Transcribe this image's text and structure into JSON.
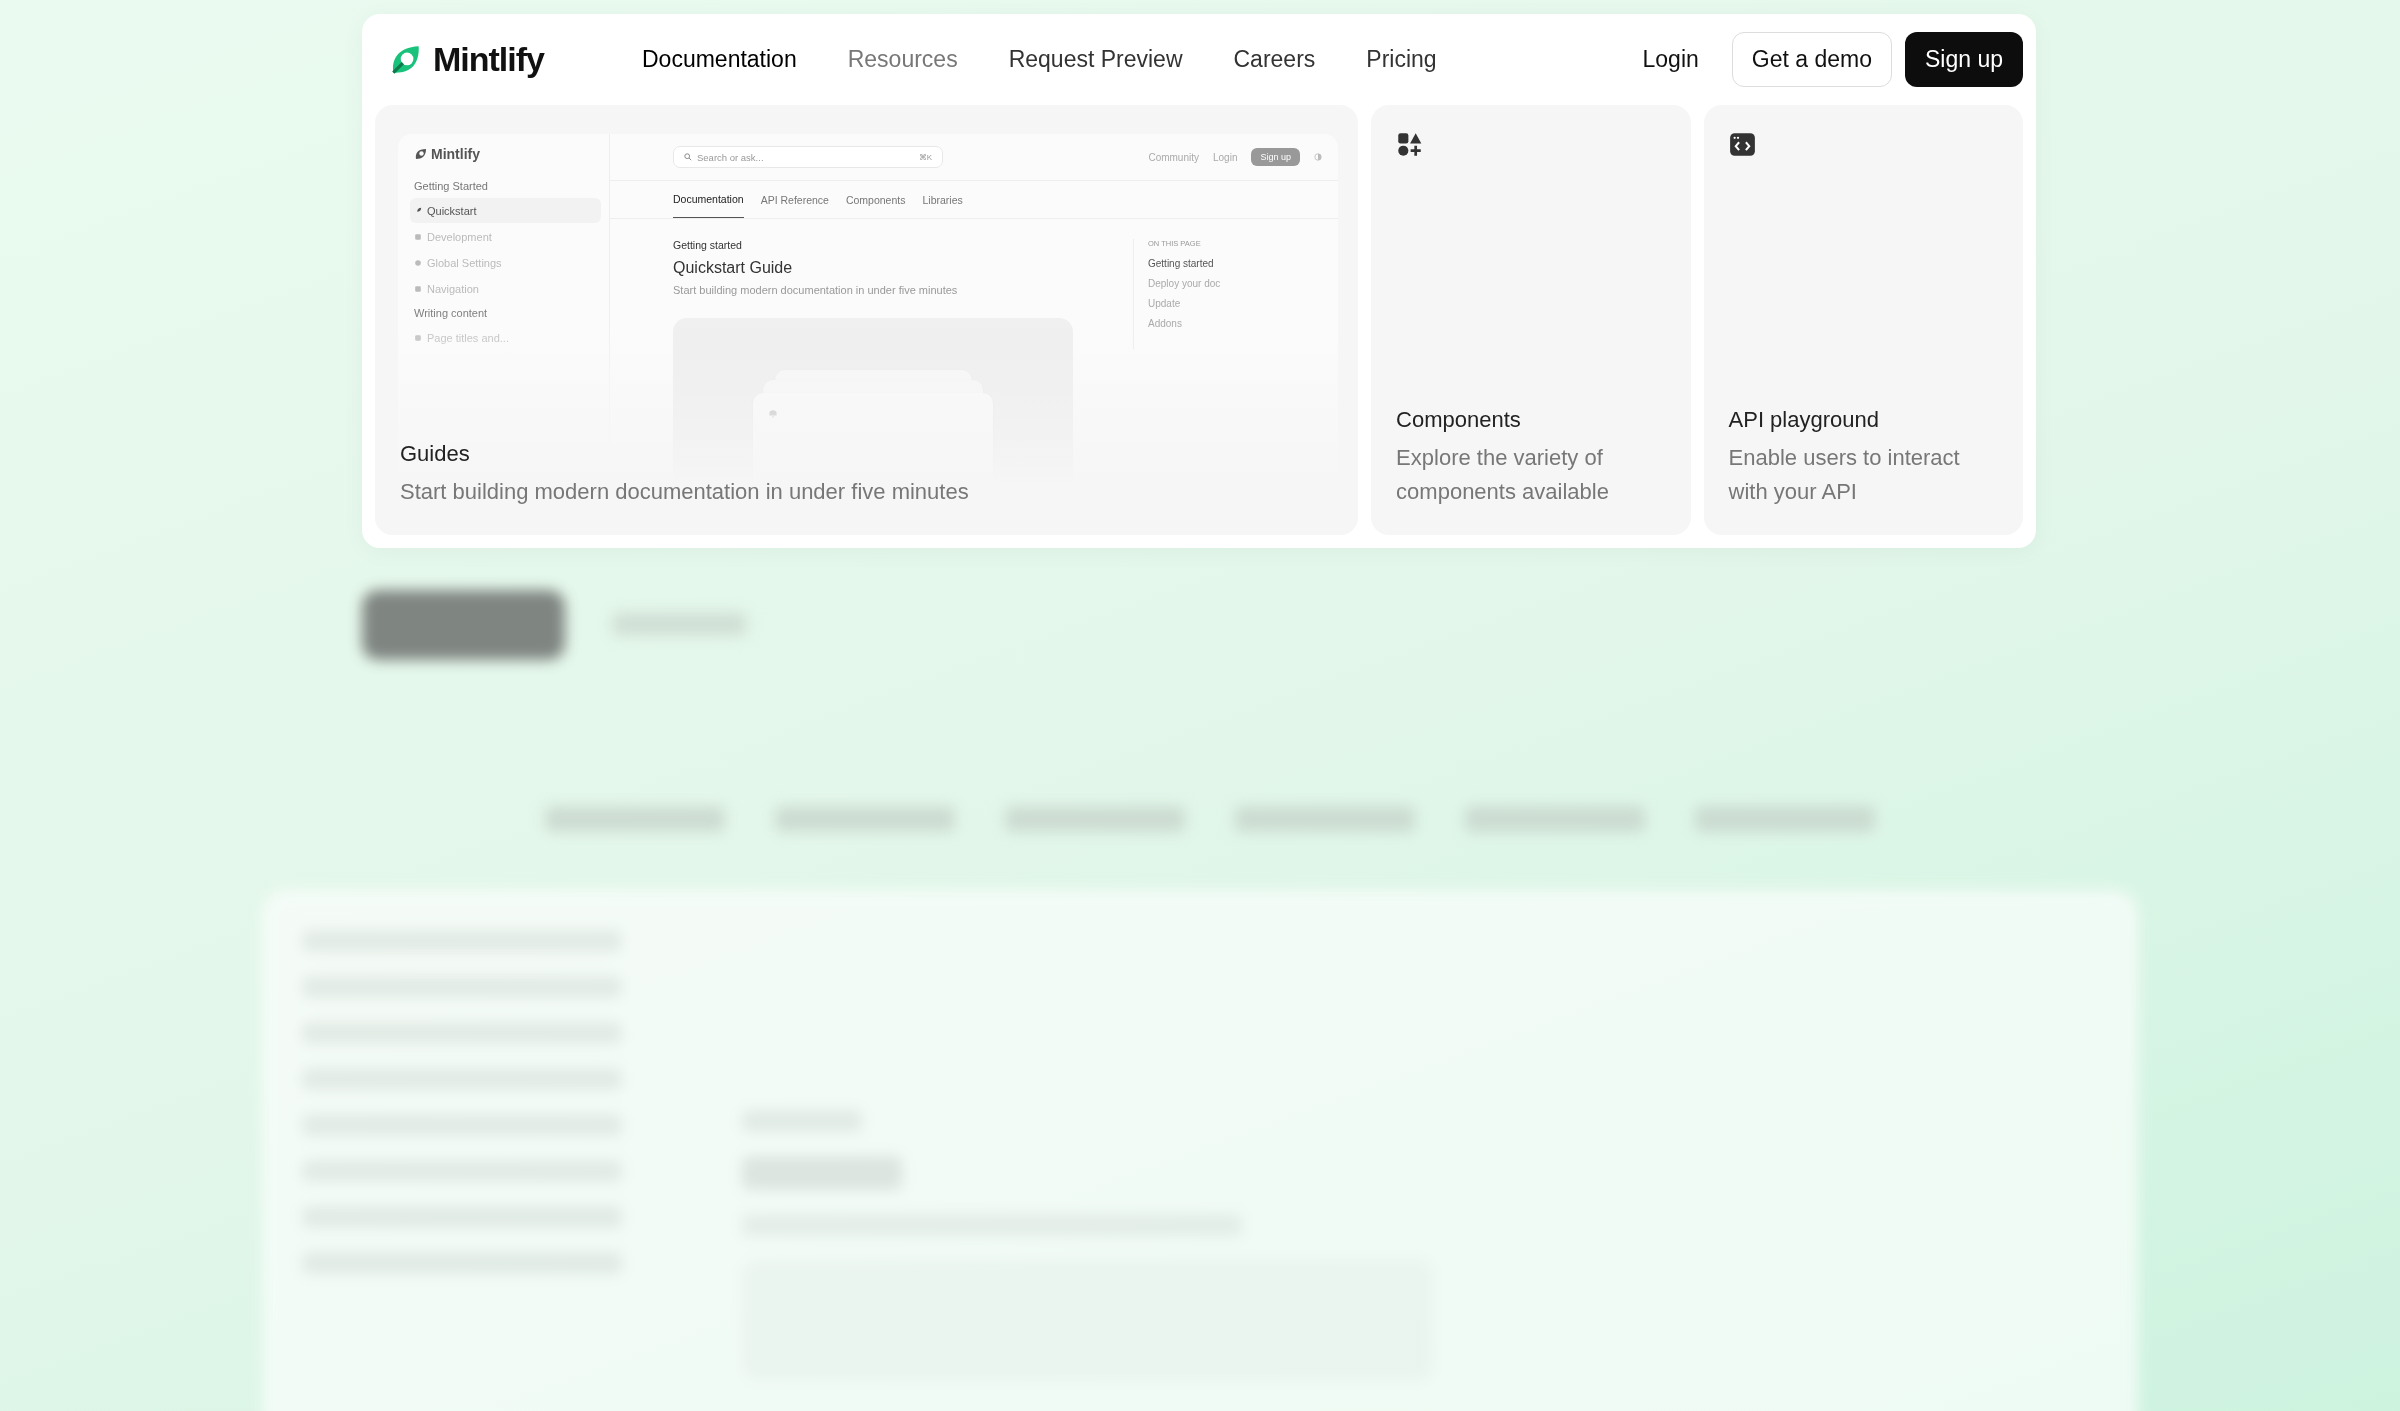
{
  "nav": {
    "logo": "Mintlify",
    "links": [
      {
        "label": "Documentation",
        "selected": true,
        "dimmed": false
      },
      {
        "label": "Resources",
        "selected": false,
        "dimmed": true
      },
      {
        "label": "Request Preview",
        "selected": false,
        "dimmed": false
      },
      {
        "label": "Careers",
        "selected": false,
        "dimmed": false
      },
      {
        "label": "Pricing",
        "selected": false,
        "dimmed": false
      }
    ],
    "login": "Login",
    "demo_button": "Get a demo",
    "signup_button": "Sign up"
  },
  "cards": [
    {
      "kind": "guide",
      "title": "Guides",
      "description": "Start building modern documentation in under five minutes"
    },
    {
      "kind": "components",
      "title": "Components",
      "description": "Explore the variety of components available"
    },
    {
      "kind": "api",
      "title": "API playground",
      "description": "Enable users to interact with your API"
    }
  ],
  "preview": {
    "logo": "Mintlify",
    "search_placeholder": "Search or ask...",
    "shortcut": "⌘K",
    "top_links": [
      "Community",
      "Login"
    ],
    "signup": "Sign up",
    "tabs": [
      {
        "label": "Documentation",
        "selected": true
      },
      {
        "label": "API Reference",
        "selected": false
      },
      {
        "label": "Components",
        "selected": false
      },
      {
        "label": "Libraries",
        "selected": false
      }
    ],
    "sidebar": [
      {
        "kind": "heading",
        "label": "Getting Started"
      },
      {
        "kind": "link",
        "label": "Quickstart",
        "selected": true
      },
      {
        "kind": "link",
        "label": "Development",
        "selected": false
      },
      {
        "kind": "link",
        "label": "Global Settings",
        "selected": false
      },
      {
        "kind": "link",
        "label": "Navigation",
        "selected": false
      },
      {
        "kind": "heading",
        "label": "Writing content"
      },
      {
        "kind": "link",
        "label": "Page titles and...",
        "selected": false
      }
    ],
    "breadcrumb": "Getting started",
    "title": "Quickstart Guide",
    "subtitle": "Start building modern documentation in under five minutes",
    "toc_heading": "ON THIS PAGE",
    "toc": [
      {
        "label": "Getting started",
        "selected": true
      },
      {
        "label": "Deploy your doc",
        "selected": false
      },
      {
        "label": "Update",
        "selected": false
      },
      {
        "label": "Addons",
        "selected": false
      }
    ]
  }
}
